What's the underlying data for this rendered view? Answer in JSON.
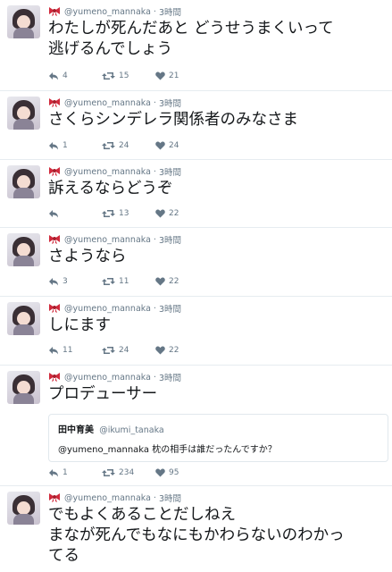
{
  "tweets": [
    {
      "handle": "@yumeno_mannaka",
      "time": "3時間",
      "lines": [
        "わたしが死んだあと どうせうまくいって",
        "逃げるんでしょう"
      ],
      "replies": "4",
      "retweets": "15",
      "likes": "21"
    },
    {
      "handle": "@yumeno_mannaka",
      "time": "3時間",
      "lines": [
        "さくらシンデレラ関係者のみなさま"
      ],
      "replies": "1",
      "retweets": "24",
      "likes": "24"
    },
    {
      "handle": "@yumeno_mannaka",
      "time": "3時間",
      "lines": [
        "訴えるならどうぞ"
      ],
      "replies": "",
      "retweets": "13",
      "likes": "22"
    },
    {
      "handle": "@yumeno_mannaka",
      "time": "3時間",
      "lines": [
        "さようなら"
      ],
      "replies": "3",
      "retweets": "11",
      "likes": "22"
    },
    {
      "handle": "@yumeno_mannaka",
      "time": "3時間",
      "lines": [
        "しにます"
      ],
      "replies": "11",
      "retweets": "24",
      "likes": "22"
    },
    {
      "handle": "@yumeno_mannaka",
      "time": "3時間",
      "lines": [
        "プロデューサー"
      ],
      "quote": {
        "name": "田中育美",
        "handle": "@ikumi_tanaka",
        "text": "@yumeno_mannaka 枕の相手は誰だったんですか？"
      },
      "replies": "1",
      "retweets": "234",
      "likes": "95"
    },
    {
      "handle": "@yumeno_mannaka",
      "time": "3時間",
      "lines": [
        "でもよくあることだしねえ",
        "まなが死んでもなにもかわらないのわかっ",
        "てる"
      ],
      "replies": "",
      "retweets": "",
      "likes": ""
    }
  ],
  "separator": "·",
  "colors": {
    "bow": "#d0293b",
    "meta": "#657786",
    "text": "#14171a",
    "border": "#e6ecf0"
  },
  "icons": {
    "reply": "reply-icon",
    "retweet": "retweet-icon",
    "like": "heart-icon",
    "bow": "ribbon-icon"
  }
}
